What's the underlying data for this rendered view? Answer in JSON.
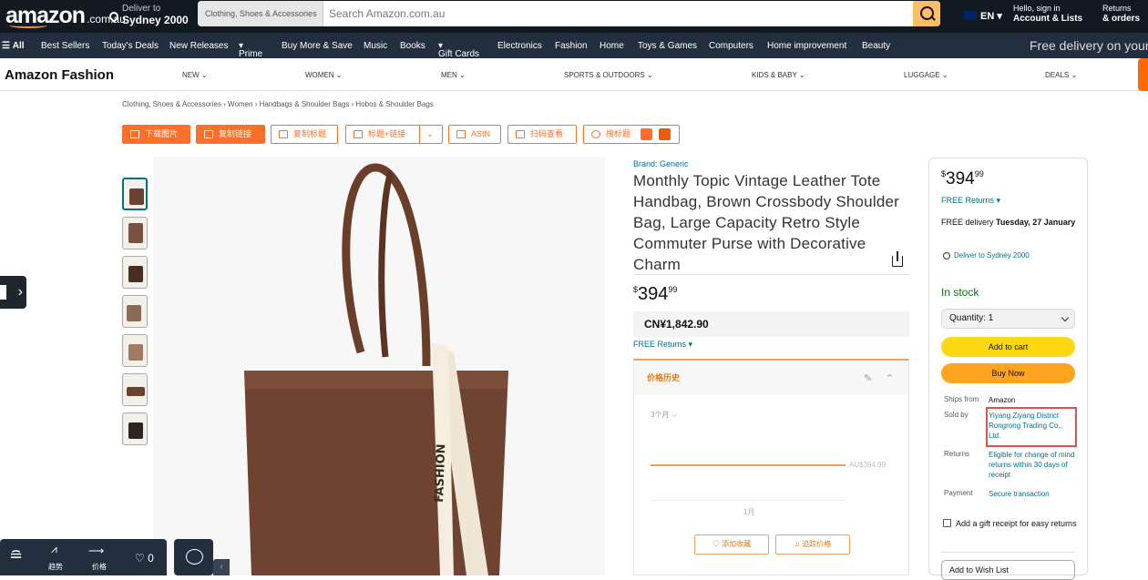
{
  "header": {
    "logo": "amazon",
    "logo_domain": ".com.au",
    "deliver_line1": "Deliver to",
    "deliver_line2": "Sydney 2000",
    "search_category": "Clothing, Shoes & Accessories",
    "search_placeholder": "Search Amazon.com.au",
    "lang": "EN",
    "account_line1": "Hello, sign in",
    "account_line2": "Account & Lists",
    "returns_line1": "Returns",
    "returns_line2": "& orders"
  },
  "nav": {
    "items": [
      "All",
      "Best Sellers",
      "Today's Deals",
      "New Releases",
      "Prime",
      "Buy More & Save",
      "Music",
      "Books",
      "Gift Cards",
      "Electronics",
      "Fashion",
      "Home",
      "Toys & Games",
      "Computers",
      "Home improvement",
      "Beauty"
    ],
    "promo": "Free delivery on your"
  },
  "subnav": {
    "brand": "Amazon Fashion",
    "items": [
      "NEW",
      "WOMEN",
      "MEN",
      "SPORTS & OUTDOORS",
      "KIDS & BABY",
      "LUGGAGE",
      "DEALS"
    ]
  },
  "breadcrumb": "Clothing, Shoes & Accessories › Women › Handbags & Shoulder Bags › Hobos & Shoulder Bags",
  "tools": [
    "下载图片",
    "复制链接",
    "复制标题",
    "标题+链接",
    "ASIN",
    "扫码查看",
    "搜标题"
  ],
  "product": {
    "brand": "Brand: Generic",
    "title": "Monthly Topic Vintage Leather Tote Handbag, Brown Crossbody Shoulder Bag, Large Capacity Retro Style Commuter Purse with Decorative Charm",
    "price_sym": "$",
    "price_whole": "394",
    "price_frac": "99",
    "cny": "CN¥1,842.90",
    "free_returns": "FREE Returns ▾"
  },
  "price_history": {
    "title": "价格历史",
    "range": "3个月 ⌵",
    "value": "AU$394.99",
    "month": "1月",
    "btn_fav": "♡ 添加收藏",
    "btn_track": "♫ 追踪价格"
  },
  "buybox": {
    "free_returns": "FREE Returns ▾",
    "delivery_prefix": "FREE delivery ",
    "delivery_date": "Tuesday, 27 January",
    "deliver_to": "Deliver to Sydney 2000",
    "stock": "In stock",
    "quantity": "Quantity: 1",
    "add_to_cart": "Add to cart",
    "buy_now": "Buy Now",
    "ships_from_label": "Ships from",
    "ships_from": "Amazon",
    "sold_by_label": "Sold by",
    "sold_by": "Yiyang Ziyang District Rongrong Trading Co., Ltd.",
    "returns_label": "Returns",
    "returns": "Eligible for change of mind returns within 30 days of receipt",
    "payment_label": "Payment",
    "payment": "Secure transaction",
    "gift": "Add a gift receipt for easy returns",
    "wishlist": "Add to Wish List"
  },
  "bottombar": {
    "trend": "趋势",
    "price": "价格",
    "count": "♡ 0"
  }
}
